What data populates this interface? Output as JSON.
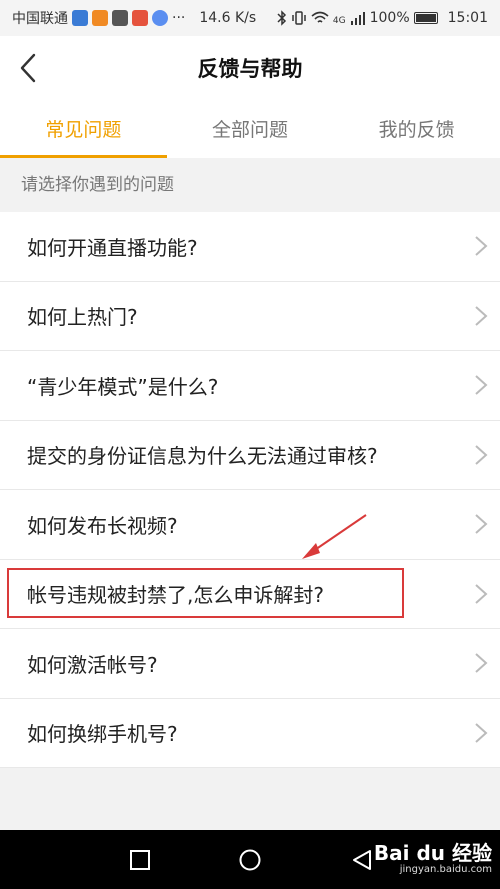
{
  "status_bar": {
    "carrier": "中国联通",
    "speed": "14.6 K/s",
    "network": "4G",
    "battery": "100%",
    "time": "15:01",
    "app_icon_colors": [
      "#3a7bd5",
      "#f08a24",
      "#555555",
      "#e5533d",
      "#5a8ef0"
    ]
  },
  "nav": {
    "title": "反馈与帮助",
    "back_icon": "chevron-left-icon"
  },
  "tabs": [
    {
      "label": "常见问题",
      "active": true
    },
    {
      "label": "全部问题",
      "active": false
    },
    {
      "label": "我的反馈",
      "active": false
    }
  ],
  "hint": "请选择你遇到的问题",
  "faq_items": [
    {
      "label": "如何开通直播功能?"
    },
    {
      "label": "如何上热门?"
    },
    {
      "label": "“青少年模式”是什么?"
    },
    {
      "label": "提交的身份证信息为什么无法通过审核?"
    },
    {
      "label": "如何发布长视频?"
    },
    {
      "label": "帐号违规被封禁了,怎么申诉解封?"
    },
    {
      "label": "如何激活帐号?"
    },
    {
      "label": "如何换绑手机号?"
    }
  ],
  "highlighted_item": "帐号违规被封禁了,怎么申诉解封?",
  "colors": {
    "accent": "#f0a000",
    "annotation": "#d93a3a",
    "system_nav": "#000000"
  },
  "watermark": {
    "main": "Bai du 经验",
    "sub": "jingyan.baidu.com"
  }
}
